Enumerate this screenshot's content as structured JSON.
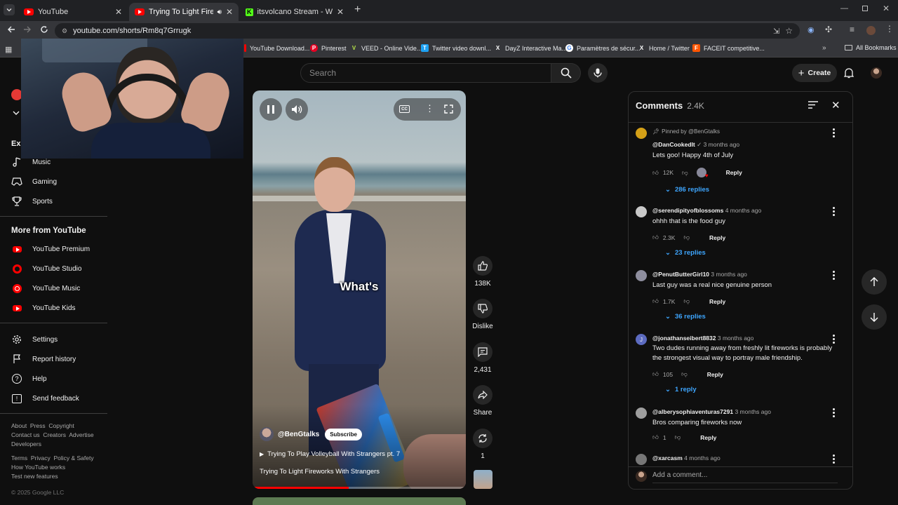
{
  "browser": {
    "tabs": [
      {
        "title": "YouTube"
      },
      {
        "title": "Trying To Light Fireworks W"
      },
      {
        "title": "itsvolcano Stream - Watch Live"
      }
    ],
    "url": "youtube.com/shorts/Rm8q7Grrugk",
    "bookmarks": [
      {
        "label": "YouTube Download...",
        "color": "#ff0000"
      },
      {
        "label": "Pinterest",
        "color": "#e60023",
        "glyph": "P"
      },
      {
        "label": "VEED - Online Vide...",
        "color": "#b6e34a",
        "glyph": "V"
      },
      {
        "label": "Twitter video downl...",
        "color": "#1da1f2",
        "glyph": "T"
      },
      {
        "label": "DayZ Interactive Ma...",
        "color": "#202124",
        "glyph": "X"
      },
      {
        "label": "Paramètres de sécur...",
        "color": "#4285f4",
        "glyph": "G"
      },
      {
        "label": "Home / Twitter",
        "color": "#202124",
        "glyph": "X"
      },
      {
        "label": "FACEIT competitive...",
        "color": "#ff5500",
        "glyph": "F"
      }
    ],
    "all_bookmarks": "All Bookmarks"
  },
  "youtube": {
    "search_placeholder": "Search",
    "create_label": "Create",
    "sidebar": {
      "explore_partial": "Exp",
      "explore_items": [
        {
          "label": "Music",
          "icon": "music-note-icon"
        },
        {
          "label": "Gaming",
          "icon": "gaming-controller-icon"
        },
        {
          "label": "Sports",
          "icon": "trophy-icon"
        }
      ],
      "more_heading": "More from YouTube",
      "more_items": [
        {
          "label": "YouTube Premium"
        },
        {
          "label": "YouTube Studio"
        },
        {
          "label": "YouTube Music"
        },
        {
          "label": "YouTube Kids"
        }
      ],
      "settings_items": [
        {
          "label": "Settings",
          "icon": "gear-icon"
        },
        {
          "label": "Report history",
          "icon": "flag-icon"
        },
        {
          "label": "Help",
          "icon": "help-icon"
        },
        {
          "label": "Send feedback",
          "icon": "feedback-icon"
        }
      ],
      "footer_row1": "About  Press  Copyright",
      "footer_row2": "Contact us  Creators  Advertise",
      "footer_row3": "Developers",
      "footer_row4": "Terms  Privacy  Policy & Safety",
      "footer_row5": "How YouTube works",
      "footer_row6": "Test new features",
      "copyright": "© 2025 Google LLC"
    },
    "short": {
      "caption": "What's",
      "channel": "@BenGtalks",
      "subscribe": "Subscribe",
      "playlist_title": "Trying To Play Volleyball With Strangers pt. 7",
      "title": "Trying To Light Fireworks With Strangers",
      "progress": 0.45
    },
    "actions": {
      "likes": "138K",
      "dislike": "Dislike",
      "comments": "2,431",
      "share": "Share",
      "remix": "1"
    },
    "comments_panel": {
      "heading": "Comments",
      "count": "2.4K",
      "pinned_by": "Pinned by @BenGtalks",
      "add_placeholder": "Add a comment...",
      "reply_label": "Reply",
      "items": [
        {
          "author": "@DanCookedIt",
          "verified": "✓",
          "time": "3 months ago",
          "text": "Lets goo! Happy 4th of July",
          "likes": "12K",
          "replies": "286 replies",
          "avatar_color": "#d4a017"
        },
        {
          "author": "@serendipityofblossoms",
          "time": "4 months ago",
          "text": "ohhh that is the food guy",
          "likes": "2.3K",
          "replies": "23 replies",
          "avatar_color": "#c9c9c9"
        },
        {
          "author": "@PenutButterGirl10",
          "time": "3 months ago",
          "text": "Last guy was a real nice genuine person",
          "likes": "1.7K",
          "replies": "36 replies",
          "avatar_color": "#8e8e9e"
        },
        {
          "author": "@jonathanseibert8832",
          "time": "3 months ago",
          "text": "Two dudes running away from freshly lit fireworks is probably the strongest visual way to portray male friendship.",
          "likes": "105",
          "replies": "1 reply",
          "avatar_color": "#5c6bc0",
          "avatar_letter": "J"
        },
        {
          "author": "@alberysophiaventuras7291",
          "time": "3 months ago",
          "text": "Bros comparing fireworks now",
          "likes": "1",
          "avatar_color": "#9e9e9e"
        },
        {
          "author": "@xarcasm",
          "time": "4 months ago",
          "avatar_color": "#777"
        }
      ]
    }
  }
}
